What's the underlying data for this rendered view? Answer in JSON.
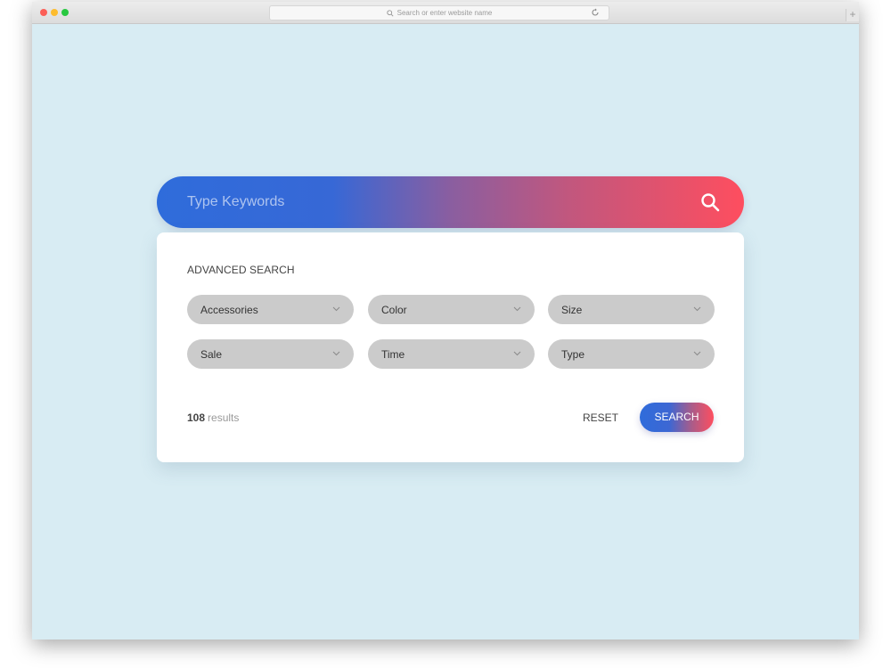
{
  "browser": {
    "address_placeholder": "Search or enter website name",
    "plus_label": "+"
  },
  "search": {
    "placeholder": "Type Keywords"
  },
  "advanced": {
    "title": "ADVANCED SEARCH",
    "filters": [
      {
        "label": "Accessories"
      },
      {
        "label": "Color"
      },
      {
        "label": "Size"
      },
      {
        "label": "Sale"
      },
      {
        "label": "Time"
      },
      {
        "label": "Type"
      }
    ],
    "results_count": "108",
    "results_word": "results",
    "reset_label": "RESET",
    "search_label": "SEARCH"
  },
  "colors": {
    "page_bg": "#d8ecf3",
    "gradient_start": "#2f6cdb",
    "gradient_end": "#fe4e5f",
    "dropdown_bg": "#cbcbcb"
  }
}
